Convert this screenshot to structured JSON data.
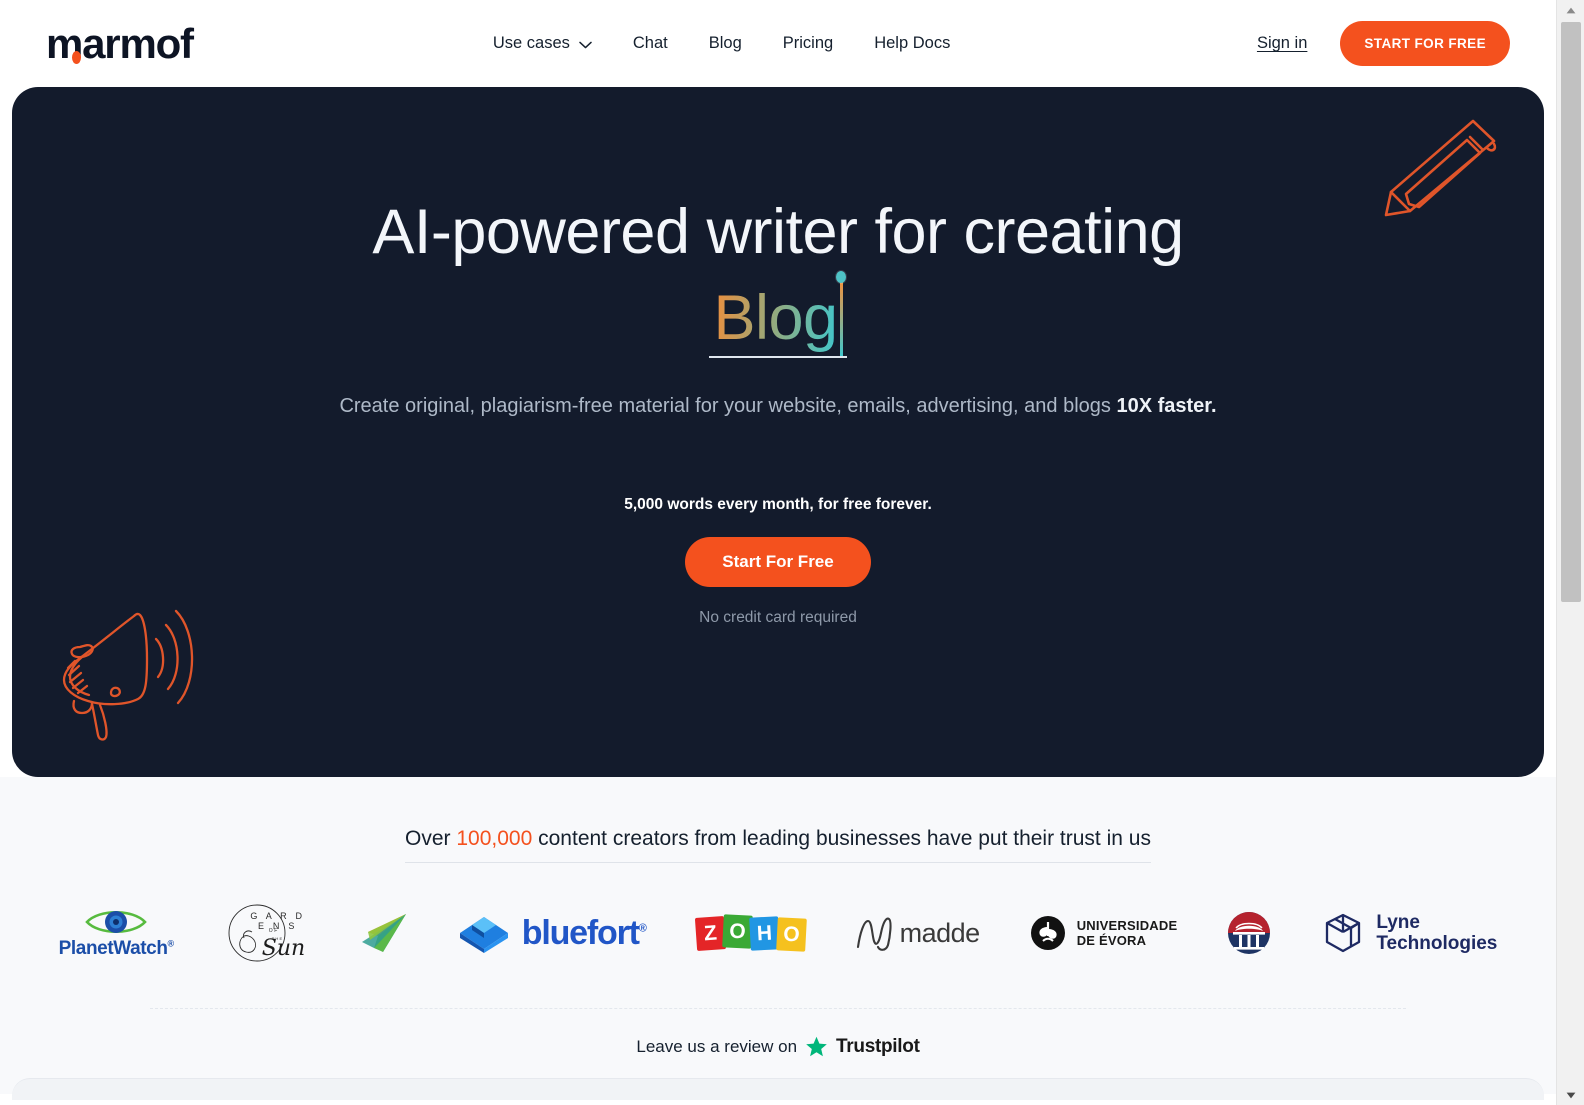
{
  "brand": {
    "logo_text": "marmof",
    "accent_color": "#f4511e",
    "hero_bg": "#131b2c"
  },
  "header": {
    "nav": [
      {
        "label": "Use cases",
        "has_chevron": true
      },
      {
        "label": "Chat",
        "has_chevron": false
      },
      {
        "label": "Blog",
        "has_chevron": false
      },
      {
        "label": "Pricing",
        "has_chevron": false
      },
      {
        "label": "Help Docs",
        "has_chevron": false
      }
    ],
    "signin_label": "Sign in",
    "cta_label": "START FOR FREE"
  },
  "hero": {
    "heading": "AI-powered writer for creating",
    "typed_word": "Blog",
    "subtitle_lead": "Create original, plagiarism-free material for your website, emails, advertising, and blogs ",
    "subtitle_bold": "10X faster.",
    "free_words_line": "5,000 words every month, for free forever.",
    "cta_label": "Start For Free",
    "no_credit_card": "No credit card required",
    "decorations": [
      "pencil-illustration",
      "megaphone-illustration"
    ]
  },
  "trust": {
    "heading_pre": "Over ",
    "heading_count": "100,000",
    "heading_post": " content creators from leading businesses have put their trust in us",
    "logos": [
      {
        "name": "PlanetWatch",
        "text": "PlanetWatch",
        "mark": "®"
      },
      {
        "name": "Gardens of the Sun",
        "line1": "G A R D E N S",
        "line2": "OF",
        "line3": "THE",
        "line4": "Sun"
      },
      {
        "name": "Paper Plane",
        "text": ""
      },
      {
        "name": "bluefort",
        "text": "bluefort",
        "mark": "®"
      },
      {
        "name": "Zoho",
        "letters": [
          "Z",
          "O",
          "H",
          "O"
        ]
      },
      {
        "name": "madde",
        "text": "madde"
      },
      {
        "name": "Universidade de Évora",
        "line1": "UNIVERSIDADE",
        "line2": "DE ÉVORA"
      },
      {
        "name": "University Seal",
        "text": ""
      },
      {
        "name": "Lyne Technologies",
        "line1": "Lyne",
        "line2": "Technologies"
      }
    ],
    "review_text": "Leave us a review on",
    "trustpilot_label": "Trustpilot"
  }
}
